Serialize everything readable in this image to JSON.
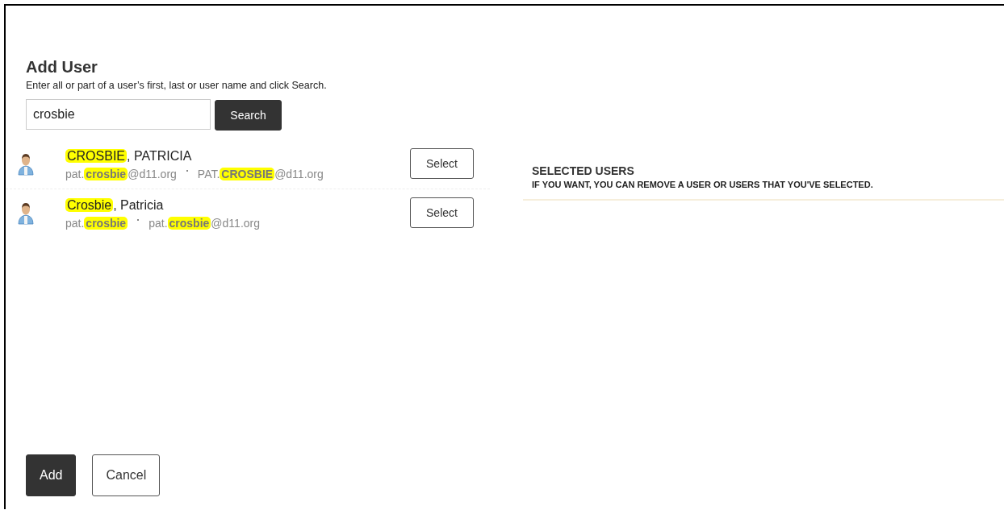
{
  "dialog": {
    "title": "Add User",
    "instructions": "Enter all or part of a user’s first, last or user name and click Search.",
    "search": {
      "value": "crosbie",
      "button": "Search"
    },
    "results": [
      {
        "name": [
          {
            "text": "CROSBIE",
            "highlight": true
          },
          {
            "text": ", PATRICIA",
            "highlight": false
          }
        ],
        "ids": [
          [
            {
              "text": "pat.",
              "highlight": false
            },
            {
              "text": "crosbie",
              "highlight": true
            },
            {
              "text": "@d11.org",
              "highlight": false
            }
          ],
          [
            {
              "text": "PAT.",
              "highlight": false
            },
            {
              "text": "CROSBIE",
              "highlight": true
            },
            {
              "text": "@d11.org",
              "highlight": false
            }
          ]
        ],
        "button": "Select"
      },
      {
        "name": [
          {
            "text": "Crosbie",
            "highlight": true
          },
          {
            "text": ", Patricia",
            "highlight": false
          }
        ],
        "ids": [
          [
            {
              "text": "pat.",
              "highlight": false
            },
            {
              "text": "crosbie",
              "highlight": true
            }
          ],
          [
            {
              "text": "pat.",
              "highlight": false
            },
            {
              "text": "crosbie",
              "highlight": true
            },
            {
              "text": "@d11.org",
              "highlight": false
            }
          ]
        ],
        "button": "Select"
      }
    ],
    "selected_users": {
      "title": "SELECTED USERS",
      "subtitle": "IF YOU WANT, YOU CAN REMOVE A USER OR USERS THAT YOU'VE SELECTED."
    },
    "buttons": [
      {
        "label": "Add",
        "kind": "primary"
      },
      {
        "label": "Cancel",
        "kind": "secondary"
      }
    ]
  }
}
